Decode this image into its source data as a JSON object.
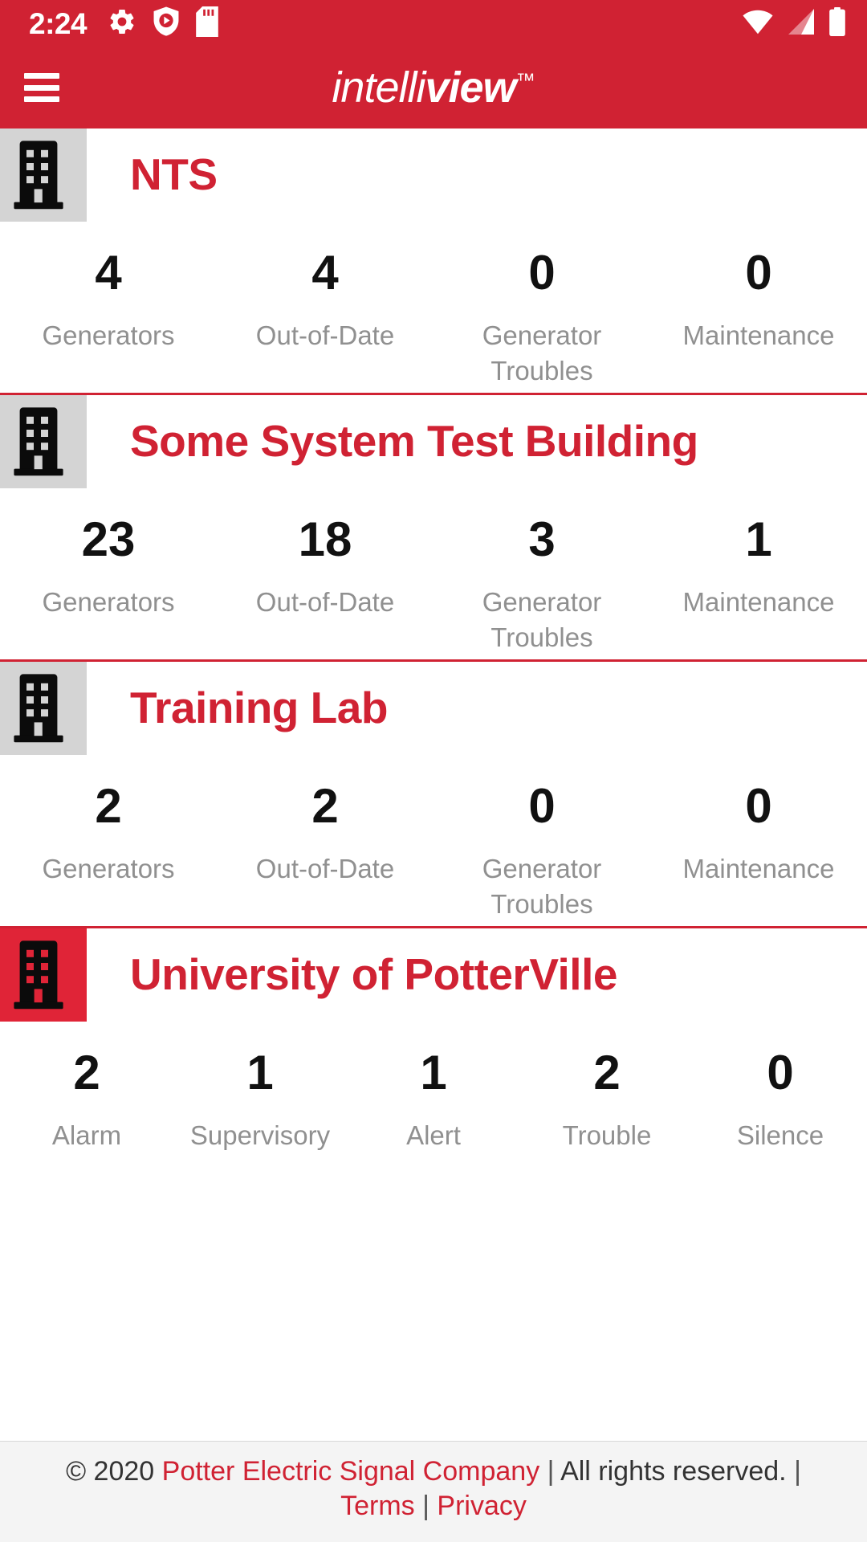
{
  "theme": {
    "brand_red": "#D02233",
    "title_red": "#D02233",
    "label_gray": "#909090",
    "value_black": "#111111",
    "icon_bg_normal": "#d4d4d4",
    "icon_bg_alarm": "#E02437",
    "footer_bg": "#f4f4f4"
  },
  "status_bar": {
    "clock": "2:24",
    "left_icons": [
      "gear-icon",
      "shield-play-icon",
      "sd-card-icon"
    ],
    "right_icons": [
      "wifi-icon",
      "cellular-signal-icon",
      "battery-icon"
    ]
  },
  "app_bar": {
    "menu_icon": "hamburger-menu-icon",
    "brand_light": "intelli",
    "brand_bold": "view",
    "brand_tm": "™"
  },
  "cards": [
    {
      "name": "NTS",
      "icon": "building-icon",
      "icon_state": "normal",
      "stats": [
        {
          "value": "4",
          "label": "Generators"
        },
        {
          "value": "4",
          "label": "Out-of-Date"
        },
        {
          "value": "0",
          "label": "Generator Troubles"
        },
        {
          "value": "0",
          "label": "Maintenance"
        }
      ]
    },
    {
      "name": "Some System Test Building",
      "icon": "building-icon",
      "icon_state": "normal",
      "stats": [
        {
          "value": "23",
          "label": "Generators"
        },
        {
          "value": "18",
          "label": "Out-of-Date"
        },
        {
          "value": "3",
          "label": "Generator Troubles"
        },
        {
          "value": "1",
          "label": "Maintenance"
        }
      ]
    },
    {
      "name": "Training Lab",
      "icon": "building-icon",
      "icon_state": "normal",
      "stats": [
        {
          "value": "2",
          "label": "Generators"
        },
        {
          "value": "2",
          "label": "Out-of-Date"
        },
        {
          "value": "0",
          "label": "Generator Troubles"
        },
        {
          "value": "0",
          "label": "Maintenance"
        }
      ]
    },
    {
      "name": "University of PotterVille",
      "icon": "building-icon",
      "icon_state": "alarm",
      "stats": [
        {
          "value": "2",
          "label": "Alarm"
        },
        {
          "value": "1",
          "label": "Supervisory"
        },
        {
          "value": "1",
          "label": "Alert"
        },
        {
          "value": "2",
          "label": "Trouble"
        },
        {
          "value": "0",
          "label": "Silence"
        }
      ]
    }
  ],
  "footer": {
    "copyright": "© 2020",
    "company": "Potter Electric Signal Company",
    "sep1": "|",
    "rights": "All rights reserved.",
    "sep2": "|",
    "terms": "Terms",
    "sep3": "|",
    "privacy": "Privacy"
  }
}
